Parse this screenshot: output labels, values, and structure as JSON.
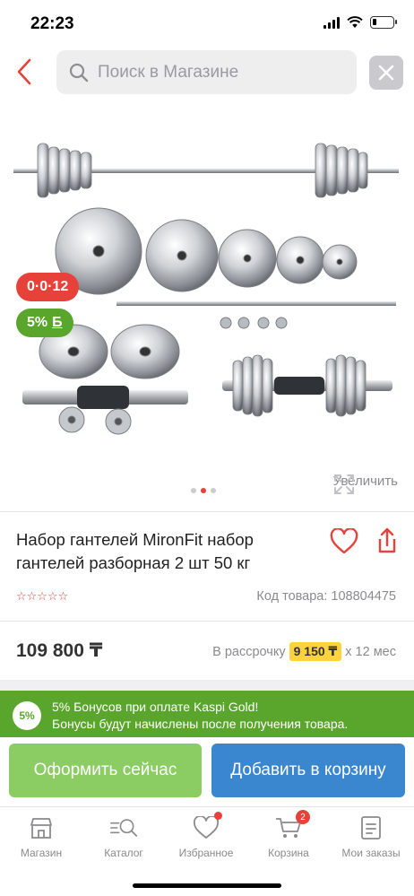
{
  "status_bar": {
    "time": "22:23"
  },
  "search": {
    "placeholder": "Поиск в Магазине"
  },
  "gallery": {
    "badge_installment": "0·0·12",
    "badge_bonus": "5%",
    "badge_bonus_currency": "Б",
    "zoom_label": "Увеличить",
    "image_count": 3,
    "active_image": 2
  },
  "product": {
    "title": "Набор гантелей MironFit набор гантелей разборная 2 шт 50 кг",
    "rating_stars": "☆☆☆☆☆",
    "rating_value": 0,
    "code_label": "Код товара: 108804475",
    "price": "109 800 ₸",
    "installment_prefix": "В рассрочку",
    "installment_amount": "9 150 ₸",
    "installment_suffix": "x 12 мес"
  },
  "bonus": {
    "circle": "5%",
    "line1": "5% Бонусов при оплате Kaspi Gold!",
    "line2": "Бонусы будут начислены после получения товара."
  },
  "actions": {
    "buy_now": "Оформить сейчас",
    "add_to_cart": "Добавить в корзину"
  },
  "tab_bar": {
    "items": [
      {
        "label": "Магазин",
        "icon": "shop-icon"
      },
      {
        "label": "Каталог",
        "icon": "catalog-search-icon"
      },
      {
        "label": "Избранное",
        "icon": "heart-icon"
      },
      {
        "label": "Корзина",
        "icon": "cart-icon",
        "badge": "2"
      },
      {
        "label": "Мои заказы",
        "icon": "orders-icon"
      }
    ]
  },
  "colors": {
    "accent_red": "#e7423a",
    "bonus_green": "#5aa52b",
    "buy_button": "#8ccd63",
    "cart_button": "#3a86cf",
    "installment_highlight": "#ffd23f"
  }
}
